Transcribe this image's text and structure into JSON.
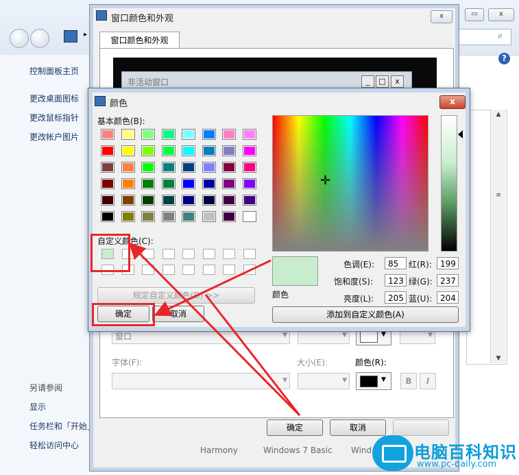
{
  "background_panel": {
    "sidebar_links": [
      "控制面板主页",
      "更改桌面图标",
      "更改鼠标指针",
      "更改帐户图片"
    ],
    "see_also_label": "另请参阅",
    "see_also_links": [
      "显示",
      "任务栏和「开始」菜单",
      "轻松访问中心"
    ],
    "help_glyph": "?"
  },
  "appearance_dialog": {
    "title": "窗口颜色和外观",
    "tab_label": "窗口颜色和外观",
    "inactive_window_title": "非活动窗口",
    "item_combo_value": "窗口",
    "font_label": "字体(F):",
    "size_label": "大小(E):",
    "color_label": "颜色(R):",
    "bold_glyph": "B",
    "italic_glyph": "I",
    "ok_label": "确定",
    "cancel_label": "取消",
    "bottom_theme_labels": [
      "Harmony",
      "Windows 7 Basic",
      "Wind"
    ],
    "selected_color": "#000000"
  },
  "color_dialog": {
    "title": "颜色",
    "close_glyph": "x",
    "basic_colors_label": "基本颜色(B):",
    "custom_colors_label": "自定义颜色(C):",
    "define_custom_label": "规定自定义颜色(D) >>",
    "ok_label": "确定",
    "cancel_label": "取消",
    "add_custom_label": "添加到自定义颜色(A)",
    "color_solid_label": "颜色",
    "hue_label": "色调(E):",
    "hue": "85",
    "sat_label": "饱和度(S):",
    "sat": "123",
    "lum_label": "亮度(L):",
    "lum": "205",
    "red_label": "红(R):",
    "red": "199",
    "green_label": "绿(G):",
    "green": "237",
    "blue_label": "蓝(U):",
    "blue": "204",
    "current_color": "#c7edcc",
    "basic_colors": [
      [
        "#ff8080",
        "#ffff80",
        "#80ff80",
        "#00ff80",
        "#80ffff",
        "#0080ff",
        "#ff80c0",
        "#ff80ff"
      ],
      [
        "#ff0000",
        "#ffff00",
        "#80ff00",
        "#00ff40",
        "#00ffff",
        "#0080c0",
        "#8080c0",
        "#ff00ff"
      ],
      [
        "#804040",
        "#ff8040",
        "#00ff00",
        "#008080",
        "#004080",
        "#8080ff",
        "#800040",
        "#ff0080"
      ],
      [
        "#800000",
        "#ff8000",
        "#008000",
        "#008040",
        "#0000ff",
        "#0000a0",
        "#800080",
        "#8000ff"
      ],
      [
        "#400000",
        "#804000",
        "#004000",
        "#004040",
        "#000080",
        "#000040",
        "#400040",
        "#400080"
      ],
      [
        "#000000",
        "#808000",
        "#808040",
        "#808080",
        "#408080",
        "#c0c0c0",
        "#400040",
        "#ffffff"
      ]
    ],
    "custom_colors": [
      [
        "#c7edcc",
        "#ffffff",
        "#ffffff",
        "#ffffff",
        "#ffffff",
        "#ffffff",
        "#ffffff",
        "#ffffff"
      ],
      [
        "#ffffff",
        "#ffffff",
        "#ffffff",
        "#ffffff",
        "#ffffff",
        "#ffffff",
        "#ffffff",
        "#ffffff"
      ]
    ]
  },
  "watermark": {
    "brand": "电脑百科知识",
    "url": "www.pc-daily.com"
  },
  "annotation_color": "#e8262a"
}
